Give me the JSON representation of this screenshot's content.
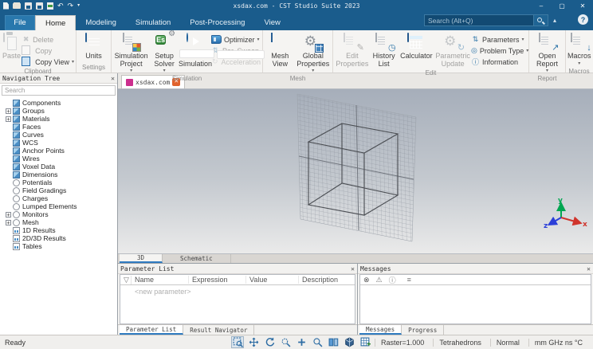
{
  "window": {
    "title": "xsdax.com - CST Studio Suite 2023"
  },
  "icons": {
    "close": "✕",
    "minimize": "–",
    "maximize": "▢",
    "caret": "▾",
    "chevron_up": "▴",
    "help": "?",
    "undo": "↶",
    "redo": "↷",
    "more": "▾",
    "delete": "✖",
    "gear": "⚙",
    "pencil": "✎",
    "clock": "◷",
    "refresh": "↻",
    "param": "⇅",
    "target": "◎",
    "info": "ⓘ",
    "arrow_out": "↗",
    "arrow_down": "↓",
    "error": "⊗",
    "warning": "⚠",
    "list": "≡",
    "filter": "▽",
    "plus": "+",
    "minus": "-",
    "solver": "Es"
  },
  "search": {
    "placeholder": "Search (Alt+Q)"
  },
  "menu": {
    "file": "File",
    "tabs": [
      "Home",
      "Modeling",
      "Simulation",
      "Post-Processing",
      "View"
    ]
  },
  "ribbon": {
    "clipboard": {
      "label": "Clipboard",
      "paste": "Paste",
      "del": "Delete",
      "copy": "Copy",
      "copy_view": "Copy View"
    },
    "settings": {
      "label": "Settings",
      "units": "Units"
    },
    "simulation": {
      "label": "Simulation",
      "project": "Simulation Project",
      "solver": "Setup Solver",
      "start": "Start Simulation",
      "optimizer": "Optimizer",
      "par_sweep": "Par. Sweep",
      "acceleration": "Acceleration"
    },
    "mesh": {
      "label": "Mesh",
      "view": "Mesh View",
      "global": "Global Properties"
    },
    "edit": {
      "label": "Edit",
      "props": "Edit Properties",
      "hist": "History List",
      "calculator": "Calculator",
      "update": "Parametric Update",
      "parameters": "Parameters",
      "problem_type": "Problem Type",
      "information": "Information"
    },
    "report": {
      "label": "Report",
      "open": "Open Report"
    },
    "macros": {
      "label": "Macros",
      "macros": "Macros"
    }
  },
  "nav": {
    "title": "Navigation Tree",
    "search_placeholder": "Search",
    "items": [
      "Components",
      "Groups",
      "Materials",
      "Faces",
      "Curves",
      "WCS",
      "Anchor Points",
      "Wires",
      "Voxel Data",
      "Dimensions",
      "Potentials",
      "Field Gradings",
      "Charges",
      "Lumped Elements",
      "Monitors",
      "Mesh",
      "1D Results",
      "2D/3D Results",
      "Tables"
    ]
  },
  "doc_tab": {
    "label": "xsdax.com"
  },
  "view_tabs": {
    "t3d": "3D",
    "schematic": "Schematic"
  },
  "params": {
    "title": "Parameter List",
    "col_name": "Name",
    "col_expr": "Expression",
    "col_value": "Value",
    "col_desc": "Description",
    "new_param": "<new parameter>",
    "tab1": "Parameter List",
    "tab2": "Result Navigator"
  },
  "messages": {
    "title": "Messages",
    "tab1": "Messages",
    "tab2": "Progress"
  },
  "status": {
    "ready": "Ready",
    "raster": "Raster=1.000",
    "mesh": "Tetrahedrons",
    "normal": "Normal",
    "units": "mm GHz ns °C"
  },
  "axes": {
    "x": "x",
    "y": "y",
    "z": "z"
  }
}
